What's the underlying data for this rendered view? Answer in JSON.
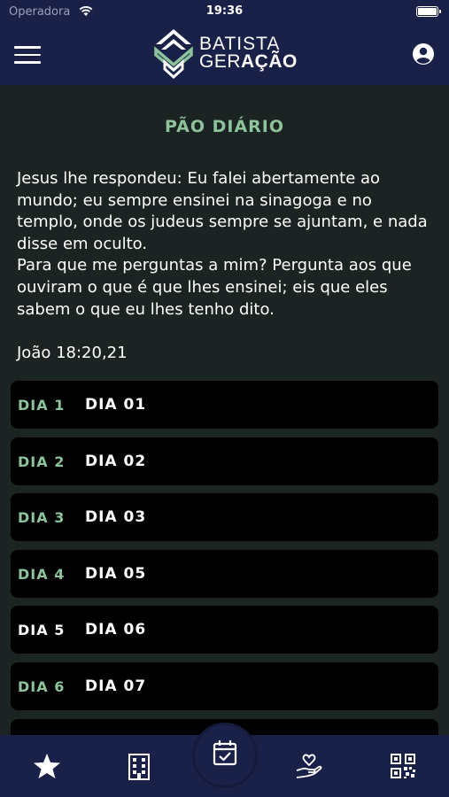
{
  "status_bar": {
    "carrier": "Operadora",
    "time": "19:36"
  },
  "header": {
    "logo_line1": "BATISTA",
    "logo_line2_a": "GER",
    "logo_line2_b": "AÇÃO"
  },
  "page": {
    "title": "PÃO DIÁRIO",
    "verse": "Jesus lhe respondeu: Eu falei abertamente ao mundo; eu sempre ensinei na sinagoga e no templo, onde os judeus sempre se ajuntam, e nada disse em oculto.\nPara que me perguntas a mim? Pergunta aos que ouviram o que é que lhes ensinei; eis que eles sabem o que eu lhes tenho dito.",
    "reference": "João 18:20,21"
  },
  "days": [
    {
      "label": "DIA 1",
      "name": "DIA 01",
      "highlight": true
    },
    {
      "label": "DIA 2",
      "name": "DIA 02",
      "highlight": true
    },
    {
      "label": "DIA 3",
      "name": "DIA 03",
      "highlight": true
    },
    {
      "label": "DIA 4",
      "name": "DIA 05",
      "highlight": true
    },
    {
      "label": "DIA 5",
      "name": "DIA 06",
      "highlight": false
    },
    {
      "label": "DIA 6",
      "name": "DIA 07",
      "highlight": true
    }
  ],
  "colors": {
    "background": "#1c2323",
    "nav": "#1a2148",
    "accent_green": "#8cc39a",
    "card": "#000000"
  },
  "tabs": [
    "star-icon",
    "building-icon",
    "calendar-check-icon",
    "heart-hand-icon",
    "qr-code-icon"
  ]
}
